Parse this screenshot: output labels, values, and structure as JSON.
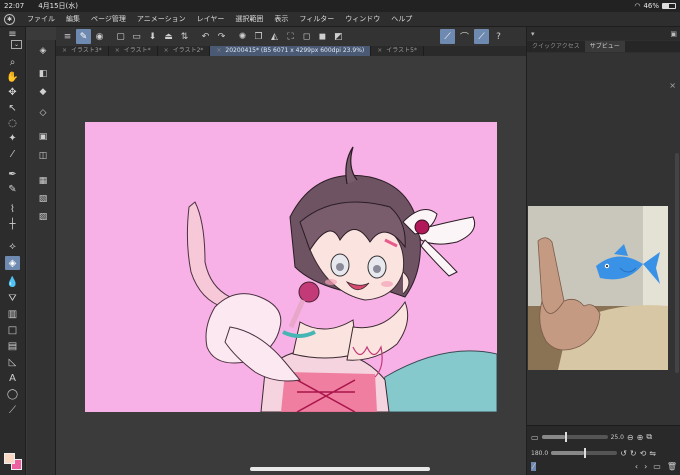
{
  "status": {
    "time": "22:07",
    "date": "4月15日(水)",
    "battery": "46%",
    "battery_level": 0.46
  },
  "menu": [
    "ファイル",
    "編集",
    "ページ管理",
    "アニメーション",
    "レイヤー",
    "選択範囲",
    "表示",
    "フィルター",
    "ウィンドウ",
    "ヘルプ"
  ],
  "tabs": [
    {
      "label": "イラスト3*",
      "active": false
    },
    {
      "label": "イラスト*",
      "active": false
    },
    {
      "label": "イラスト2*",
      "active": false
    },
    {
      "label": "20200415* (B5 6071 x 4299px 600dpi 23.9%)",
      "active": true
    },
    {
      "label": "イラスト5*",
      "active": false
    }
  ],
  "panel": {
    "tabs": [
      {
        "label": "クイックアクセス",
        "active": false
      },
      {
        "label": "サブビュー",
        "active": true
      }
    ]
  },
  "bottom": {
    "zoom_value": "25.0",
    "rotate_value": "180.0",
    "zoom_level": 0.35,
    "rotate_level": 0.5
  },
  "colors": {
    "canvas_bg": "#f7b1e6",
    "accent": "#6f8ab0",
    "foreground_color": "#fbd8c4",
    "background_color": "#ee5fa0",
    "fish_sticker": "#3a92e6"
  }
}
